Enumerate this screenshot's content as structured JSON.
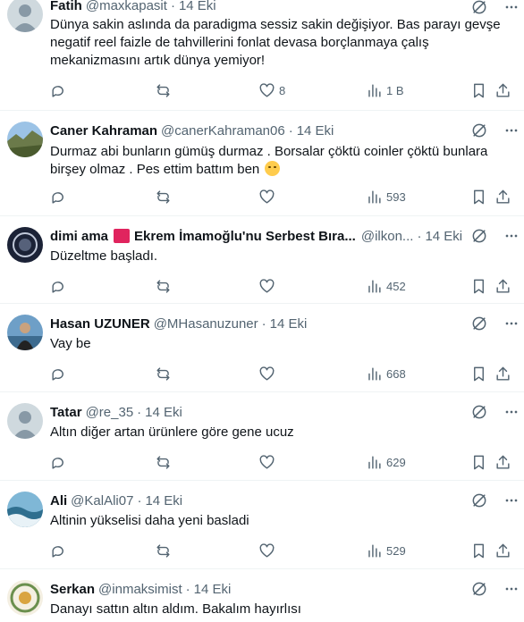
{
  "tweets": [
    {
      "name": "Fatih",
      "handle": "@maxkapasit",
      "time": "14 Eki",
      "lines": [
        "Dünya sakin aslında da paradigma sessiz sakin değişiyor. Bas parayı gevşe",
        "negatif reel faizle de tahvillerini fonlat devasa borçlanmaya çalış",
        "mekanizmasını artık dünya yemiyor!"
      ],
      "likes": "8",
      "views": "1 B"
    },
    {
      "name": "Caner Kahraman",
      "handle": "@canerKahraman06",
      "time": "14 Eki",
      "lines": [
        "Durmaz abi bunların gümüş durmaz . Borsalar çöktü coinler çöktü bunlara",
        "birşey olmaz . Pes ettim battım ben"
      ],
      "emoji": "disappointed-face",
      "likes": "",
      "views": "593"
    },
    {
      "name": "dimi ama",
      "name2": "Ekrem İmamoğlu'nu Serbest Bıra...",
      "handle": "@ilkon...",
      "time": "14 Eki",
      "lines": [
        "Düzeltme başladı."
      ],
      "likes": "",
      "views": "452"
    },
    {
      "name": "Hasan UZUNER",
      "handle": "@MHasanuzuner",
      "time": "14 Eki",
      "lines": [
        "Vay be"
      ],
      "likes": "",
      "views": "668"
    },
    {
      "name": "Tatar",
      "handle": "@re_35",
      "time": "14 Eki",
      "lines": [
        "Altın diğer artan ürünlere göre gene ucuz"
      ],
      "likes": "",
      "views": "629"
    },
    {
      "name": "Ali",
      "handle": "@KalAli07",
      "time": "14 Eki",
      "lines": [
        "Altinin  yükselisi daha yeni basladi"
      ],
      "likes": "",
      "views": "529"
    },
    {
      "name": "Serkan",
      "handle": "@inmaksimist",
      "time": "14 Eki",
      "lines": [
        "Danayı sattın altın aldım. Bakalım hayırlısı"
      ],
      "likes": "",
      "views": ""
    }
  ],
  "icons": {
    "reply": "reply-icon",
    "repost": "repost-icon",
    "like": "heart-icon",
    "views": "views-icon",
    "bookmark": "bookmark-icon",
    "share": "share-icon",
    "grok": "grok-icon",
    "more": "more-icon"
  },
  "colors": {
    "text": "#0f1419",
    "secondary": "#536471",
    "divider": "#eff3f4",
    "flag": "#e0245e"
  }
}
